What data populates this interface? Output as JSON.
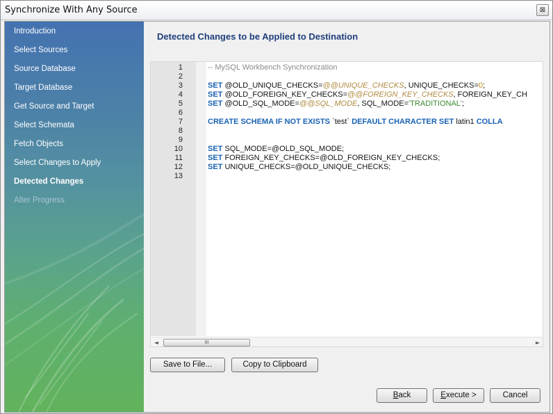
{
  "window": {
    "title": "Synchronize With Any Source",
    "close_glyph": "⊠"
  },
  "sidebar": {
    "items": [
      {
        "label": "Introduction",
        "state": "normal"
      },
      {
        "label": "Select Sources",
        "state": "normal"
      },
      {
        "label": "Source Database",
        "state": "normal"
      },
      {
        "label": "Target Database",
        "state": "normal"
      },
      {
        "label": "Get Source and Target",
        "state": "normal"
      },
      {
        "label": "Select Schemata",
        "state": "normal"
      },
      {
        "label": "Fetch Objects",
        "state": "normal"
      },
      {
        "label": "Select Changes to Apply",
        "state": "normal"
      },
      {
        "label": "Detected Changes",
        "state": "active"
      },
      {
        "label": "Alter Progress",
        "state": "disabled"
      }
    ]
  },
  "main": {
    "heading": "Detected Changes to be Applied to Destination"
  },
  "editor": {
    "line_numbers": [
      "1",
      "2",
      "3",
      "4",
      "5",
      "6",
      "7",
      "8",
      "9",
      "10",
      "11",
      "12",
      "13"
    ],
    "lines": [
      {
        "comment": "-- MySQL Workbench Synchronization"
      },
      {},
      {
        "kw": "SET",
        "a": " @OLD_UNIQUE_CHECKS=",
        "var": "@@UNIQUE_CHECKS",
        "b": ", UNIQUE_CHECKS=",
        "num": "0",
        "c": ";"
      },
      {
        "kw": "SET",
        "a": " @OLD_FOREIGN_KEY_CHECKS=",
        "var": "@@FOREIGN_KEY_CHECKS",
        "b": ", FOREIGN_KEY_CH"
      },
      {
        "kw": "SET",
        "a": " @OLD_SQL_MODE=",
        "var": "@@SQL_MODE",
        "b": ", SQL_MODE=",
        "str": "'TRADITIONAL'",
        "c": ";"
      },
      {},
      {
        "kw1": "CREATE SCHEMA IF NOT EXISTS",
        "a": " `test` ",
        "kw2": "DEFAULT CHARACTER SET",
        "b": " latin1 ",
        "kw3": "COLLA"
      },
      {},
      {},
      {
        "kw": "SET",
        "a": " SQL_MODE=@OLD_SQL_MODE;"
      },
      {
        "kw": "SET",
        "a": " FOREIGN_KEY_CHECKS=@OLD_FOREIGN_KEY_CHECKS;"
      },
      {
        "kw": "SET",
        "a": " UNIQUE_CHECKS=@OLD_UNIQUE_CHECKS;"
      }
    ],
    "scroll_left_glyph": "◄",
    "scroll_right_glyph": "►",
    "thumb_grip": "III"
  },
  "buttons": {
    "save_to_file": "Save to File...",
    "copy_to_clipboard": "Copy to Clipboard",
    "back_mnemonic": "B",
    "back_rest": "ack",
    "execute_mnemonic": "E",
    "execute_rest": "xecute >",
    "cancel": "Cancel"
  }
}
